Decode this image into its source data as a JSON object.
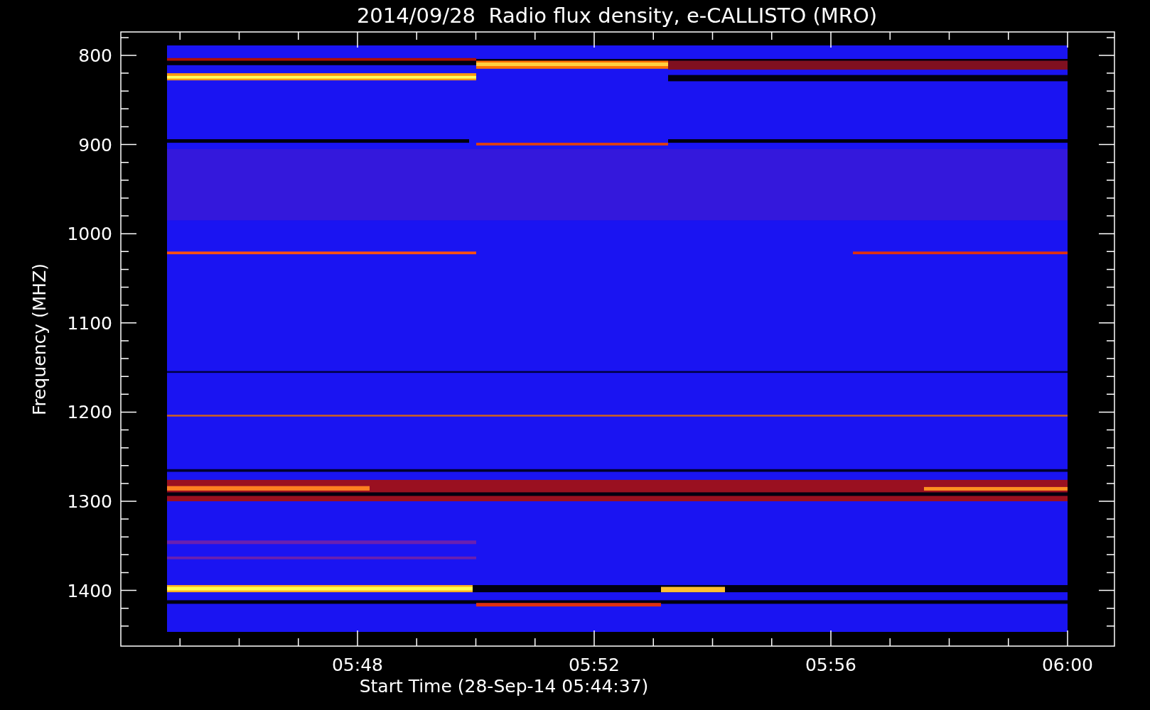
{
  "title": "2014/09/28  Radio flux density, e-CALLISTO (MRO)",
  "y_axis": {
    "label": "Frequency (MHZ)",
    "ticks": [
      "800",
      "900",
      "1000",
      "1100",
      "1200",
      "1300",
      "1400"
    ]
  },
  "x_axis": {
    "label": "Start Time (28-Sep-14 05:44:37)",
    "ticks": [
      "05:48",
      "05:52",
      "05:56",
      "06:00"
    ]
  }
}
